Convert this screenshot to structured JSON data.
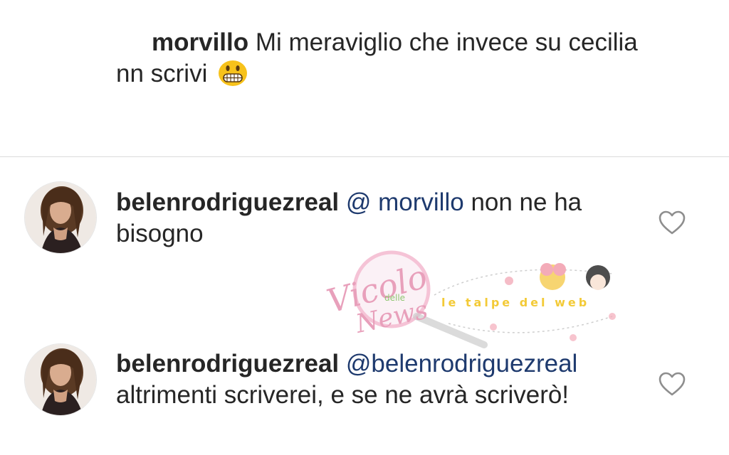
{
  "top_comment": {
    "username": "morvillo",
    "text": "Mi meraviglio che invece su cecilia nn scrivi",
    "emoji": "grinning-face-emoji"
  },
  "replies": [
    {
      "username": "belenrodriguezreal",
      "mention": "@ morvillo",
      "text": "non ne ha bisogno",
      "like_icon": "heart-outline-icon"
    },
    {
      "username": "belenrodriguezreal",
      "mention": "@belenrodriguezreal",
      "text": "altrimenti scriverei, e se ne avrà scriverò!",
      "like_icon": "heart-outline-icon"
    }
  ],
  "watermark": {
    "logo_text": "Vicolo delle News",
    "logo_text_2": "le talpe del web"
  }
}
